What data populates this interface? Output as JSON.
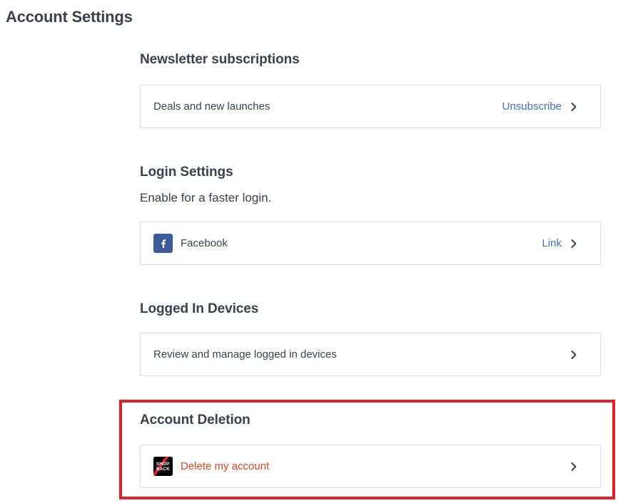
{
  "page": {
    "title": "Account Settings"
  },
  "newsletter": {
    "title": "Newsletter subscriptions",
    "item_label": "Deals and new launches",
    "action_label": "Unsubscribe"
  },
  "login": {
    "title": "Login Settings",
    "subtitle": "Enable for a faster login.",
    "item_label": "Facebook",
    "action_label": "Link",
    "icon": "facebook-icon"
  },
  "devices": {
    "title": "Logged In Devices",
    "item_label": "Review and manage logged in devices"
  },
  "deletion": {
    "title": "Account Deletion",
    "item_label": "Delete my account",
    "icon": "shopback-logo",
    "icon_text_top": "SHOP",
    "icon_text_bottom": "BACK"
  },
  "colors": {
    "link": "#3d6fc4",
    "danger": "#e8431c",
    "highlight": "#e2202a",
    "facebook": "#3b5a9a"
  }
}
